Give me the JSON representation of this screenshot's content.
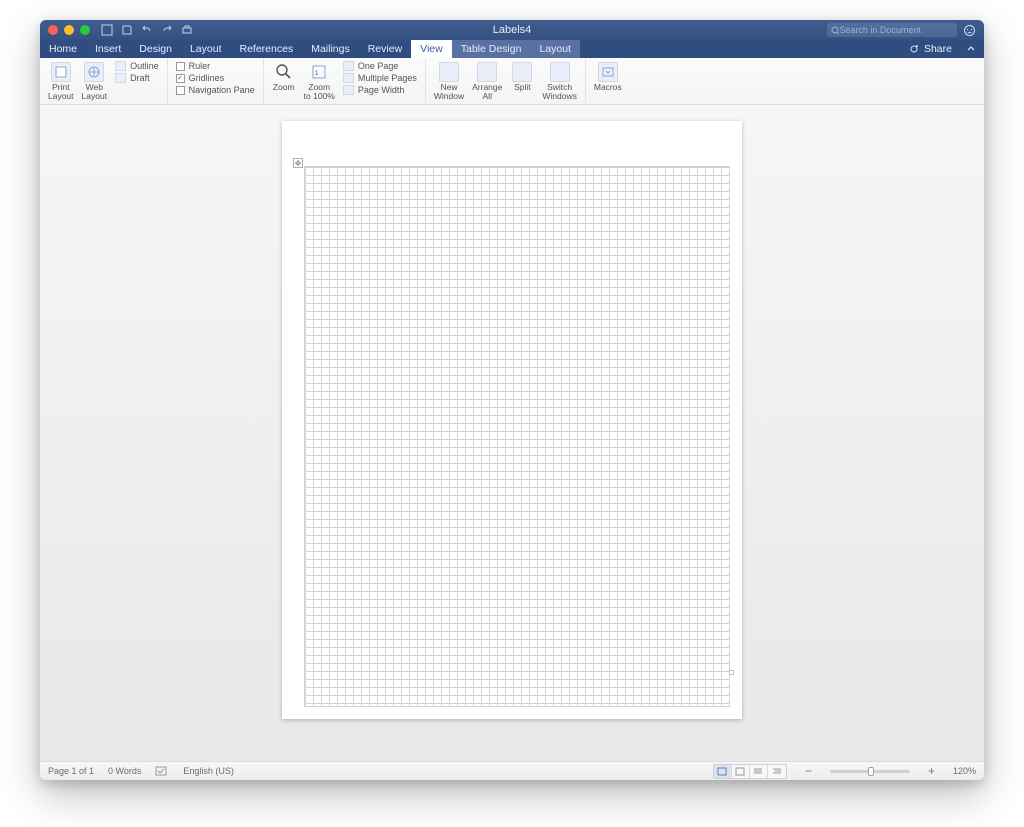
{
  "title": "Labels4",
  "search_placeholder": "Search in Document",
  "tabs": {
    "home": "Home",
    "insert": "Insert",
    "design": "Design",
    "layout": "Layout",
    "references": "References",
    "mailings": "Mailings",
    "review": "Review",
    "view": "View",
    "table_design": "Table Design",
    "table_layout": "Layout"
  },
  "share_label": "Share",
  "ribbon": {
    "print_layout": "Print\nLayout",
    "web_layout": "Web\nLayout",
    "outline": "Outline",
    "draft": "Draft",
    "ruler": "Ruler",
    "gridlines": "Gridlines",
    "navpane": "Navigation Pane",
    "zoom": "Zoom",
    "zoom_100": "Zoom\nto 100%",
    "one_page": "One Page",
    "multiple_pages": "Multiple Pages",
    "page_width": "Page Width",
    "new_window": "New\nWindow",
    "arrange_all": "Arrange\nAll",
    "split": "Split",
    "switch_windows": "Switch\nWindows",
    "macros": "Macros"
  },
  "status": {
    "page": "Page 1 of 1",
    "words": "0 Words",
    "language": "English (US)",
    "zoom": "120%"
  },
  "checks": {
    "ruler": false,
    "gridlines": true,
    "navpane": false
  }
}
